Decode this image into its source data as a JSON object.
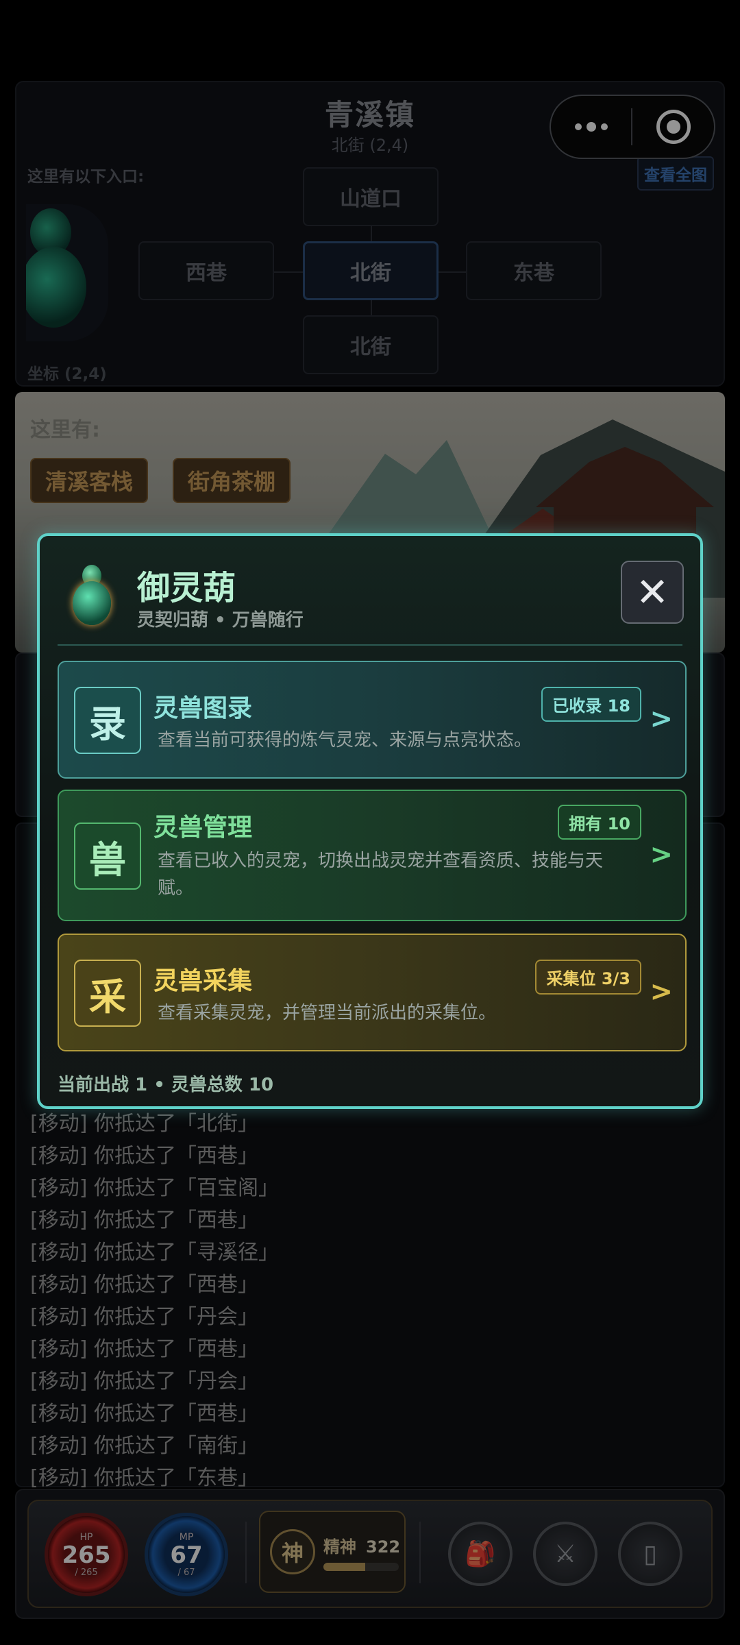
{
  "map": {
    "town_name": "青溪镇",
    "location": "北街 (2,4)",
    "exits_label": "这里有以下入口:",
    "view_all": "查看全图",
    "coord_label": "坐标 (2,4)",
    "nodes": {
      "north": "山道口",
      "west": "西巷",
      "center": "北街",
      "east": "东巷",
      "south": "北街"
    }
  },
  "scene": {
    "label": "这里有:",
    "places": [
      "清溪客栈",
      "街角茶棚"
    ]
  },
  "log": [
    "[移动] 你抵达了「北街」",
    "[移动] 你抵达了「西巷」",
    "[移动] 你抵达了「百宝阁」",
    "[移动] 你抵达了「西巷」",
    "[移动] 你抵达了「寻溪径」",
    "[移动] 你抵达了「西巷」",
    "[移动] 你抵达了「丹会」",
    "[移动] 你抵达了「西巷」",
    "[移动] 你抵达了「丹会」",
    "[移动] 你抵达了「西巷」",
    "[移动] 你抵达了「南街」",
    "[移动] 你抵达了「东巷」"
  ],
  "status": {
    "hp": {
      "label": "HP",
      "value": "265",
      "max": "/ 265"
    },
    "mp": {
      "label": "MP",
      "value": "67",
      "max": "/ 67"
    },
    "spirit": {
      "icon_char": "神",
      "label": "精神",
      "value": "322",
      "fill_fraction": 0.55
    },
    "buttons": [
      "bag-icon",
      "crossed-swords-icon",
      "phone-icon"
    ]
  },
  "modal": {
    "title": "御灵葫",
    "subtitle": "灵契归葫 • 万兽随行",
    "close_glyph": "✕",
    "cards": [
      {
        "icon_char": "录",
        "title": "灵兽图录",
        "tag": "已收录 18",
        "desc": "查看当前可获得的炼气灵宠、来源与点亮状态。",
        "arrow": ">"
      },
      {
        "icon_char": "兽",
        "title": "灵兽管理",
        "tag": "拥有 10",
        "desc": "查看已收入的灵宠，切换出战灵宠并查看资质、技能与天赋。",
        "arrow": ">"
      },
      {
        "icon_char": "采",
        "title": "灵兽采集",
        "tag": "采集位 3/3",
        "desc": "查看采集灵宠，并管理当前派出的采集位。",
        "arrow": ">"
      }
    ],
    "footer": "当前出战 1 • 灵兽总数 10"
  },
  "colors": {
    "modal_border": "#5fd2c9",
    "teal": "#8fe3dc",
    "green": "#7fe09b",
    "gold": "#f3d45e"
  }
}
